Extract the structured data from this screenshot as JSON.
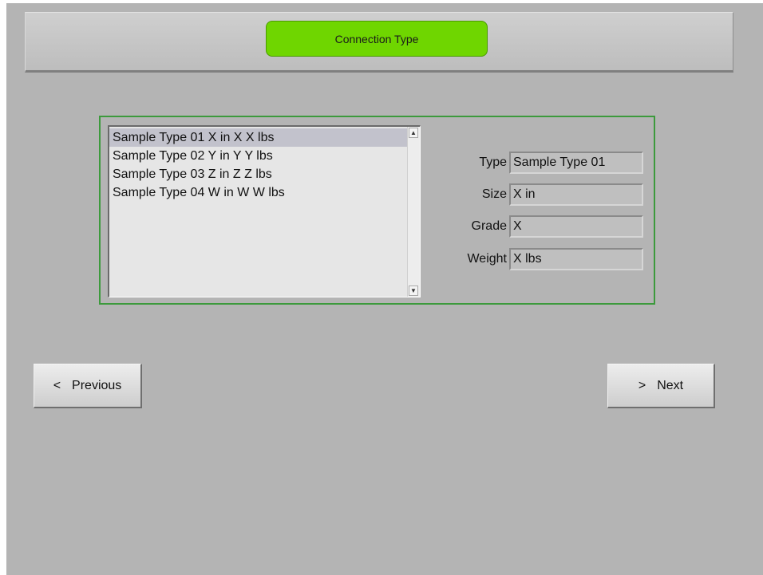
{
  "header": {
    "title": "Connection Type"
  },
  "list": {
    "items": [
      "Sample Type 01 X in X X lbs",
      "Sample Type 02 Y in Y Y lbs",
      "Sample Type 03 Z in Z Z lbs",
      "Sample Type 04 W in W W lbs"
    ],
    "selected_index": 0,
    "scroll_up_icon": "chevron-up-icon",
    "scroll_down_icon": "chevron-down-icon"
  },
  "details": {
    "type_label": "Type",
    "type_value": "Sample Type 01",
    "size_label": "Size",
    "size_value": "X in",
    "grade_label": "Grade",
    "grade_value": "X",
    "weight_label": "Weight",
    "weight_value": "X lbs"
  },
  "nav": {
    "prev_arrow": "<",
    "prev_label": "Previous",
    "next_arrow": ">",
    "next_label": "Next"
  },
  "colors": {
    "background": "#b4b4b4",
    "title_pill": "#6fd600",
    "group_border": "#3c9a3c"
  }
}
